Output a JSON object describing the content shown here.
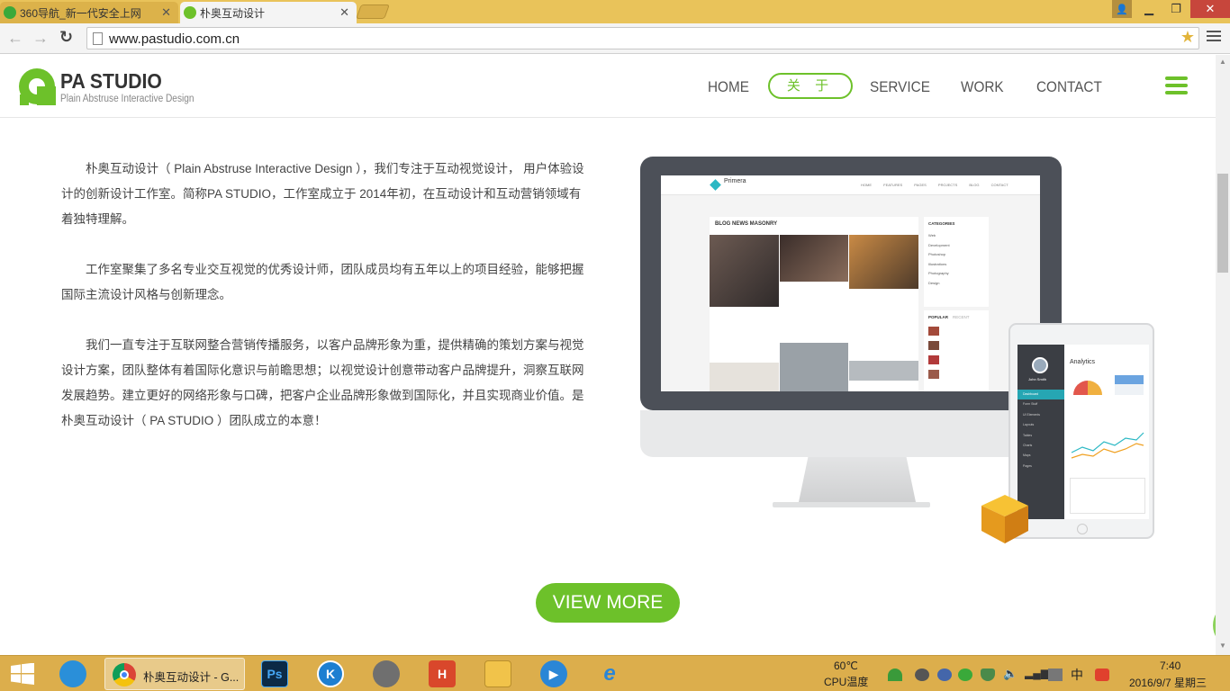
{
  "browser": {
    "tabs": [
      {
        "title": "360导航_新一代安全上网"
      },
      {
        "title": "朴奥互动设计"
      }
    ],
    "url": "www.pastudio.com.cn"
  },
  "site": {
    "logo": {
      "title": "PA STUDIO",
      "subtitle": "Plain Abstruse Interactive Design"
    },
    "nav": [
      {
        "label": "HOME"
      },
      {
        "label": "关 于"
      },
      {
        "label": "SERVICE"
      },
      {
        "label": "WORK"
      },
      {
        "label": "CONTACT"
      }
    ],
    "paragraphs": [
      "朴奥互动设计（ Plain Abstruse Interactive Design ），我们专注于互动视觉设计， 用户体验设计的创新设计工作室。简称PA STUDIO，工作室成立于 2014年初，在互动设计和互动营销领域有着独特理解。",
      "工作室聚集了多名专业交互视觉的优秀设计师，团队成员均有五年以上的项目经验，能够把握国际主流设计风格与创新理念。",
      "我们一直专注于互联网整合营销传播服务，以客户品牌形象为重，提供精确的策划方案与视觉设计方案，团队整体有着国际化意识与前瞻思想；以视觉设计创意带动客户品牌提升，洞察互联网发展趋势。建立更好的网络形象与口碑，把客户企业品牌形象做到国际化，并且实现商业价值。是朴奥互动设计（ PA STUDIO ）团队成立的本意！"
    ],
    "view_more": "VIEW MORE",
    "mock": {
      "brand": "Primera",
      "nav": [
        "HOME",
        "FEATURES",
        "PAGES",
        "PROJECTS",
        "BLOG",
        "CONTACT"
      ],
      "section_title": "BLOG NEWS MASONRY",
      "categories_title": "CATEGORIES",
      "categories": [
        "Web",
        "Development",
        "Photoshop",
        "Illustrations",
        "Photography",
        "Design"
      ],
      "popular": "POPULAR",
      "recent": "RECENT",
      "tablet_title": "Analytics",
      "tablet_user": "John Smith",
      "tablet_menu": [
        "Dashboard",
        "Form Stuff",
        "UI Elements",
        "Layouts",
        "Tables",
        "Charts",
        "Maps",
        "Pages"
      ]
    }
  },
  "taskbar": {
    "chrome_task": "朴奥互动设计 - G...",
    "temp": "60℃",
    "temp_label": "CPU温度",
    "ime": "中",
    "time": "7:40",
    "date": "2016/9/7 星期三"
  },
  "colors": {
    "accent": "#6dc12a",
    "tabbar": "#e9c35a",
    "taskbar": "#dcae4c"
  }
}
